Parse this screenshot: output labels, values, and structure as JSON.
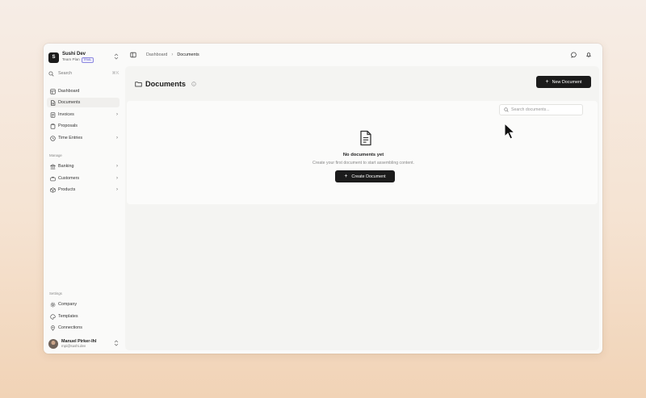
{
  "workspace": {
    "initial": "S",
    "name": "Sushi Dev",
    "plan": "Team Plan",
    "badge": "TRIAL"
  },
  "sidebar": {
    "search_placeholder": "Search",
    "search_shortcut": "⌘K",
    "items": [
      {
        "label": "Dashboard",
        "icon": "grid-icon"
      },
      {
        "label": "Documents",
        "icon": "document-icon",
        "active": true
      },
      {
        "label": "Invoices",
        "icon": "invoice-icon",
        "has_submenu": true
      },
      {
        "label": "Proposals",
        "icon": "proposal-icon"
      },
      {
        "label": "Time Entries",
        "icon": "clock-icon",
        "has_submenu": true
      }
    ],
    "manage_label": "Manage",
    "manage_items": [
      {
        "label": "Banking",
        "icon": "bank-icon",
        "has_submenu": true
      },
      {
        "label": "Customers",
        "icon": "customers-icon",
        "has_submenu": true
      },
      {
        "label": "Products",
        "icon": "box-icon",
        "has_submenu": true
      }
    ],
    "settings_label": "Settings",
    "settings_items": [
      {
        "label": "Company",
        "icon": "gear-icon"
      },
      {
        "label": "Templates",
        "icon": "palette-icon"
      },
      {
        "label": "Connections",
        "icon": "pin-icon"
      }
    ]
  },
  "user": {
    "name": "Manuel Pirker-Ihl",
    "email": "mpi@sushi.dev"
  },
  "breadcrumb": {
    "parent": "Dashboard",
    "current": "Documents"
  },
  "page": {
    "title": "Documents",
    "new_button": "New Document",
    "search_placeholder": "Search documents...",
    "empty_title": "No documents yet",
    "empty_subtitle": "Create your first document to start assembling content.",
    "create_button": "Create Document"
  },
  "colors": {
    "accent": "#1b1b1b",
    "trial_badge": "#5a55c8"
  }
}
